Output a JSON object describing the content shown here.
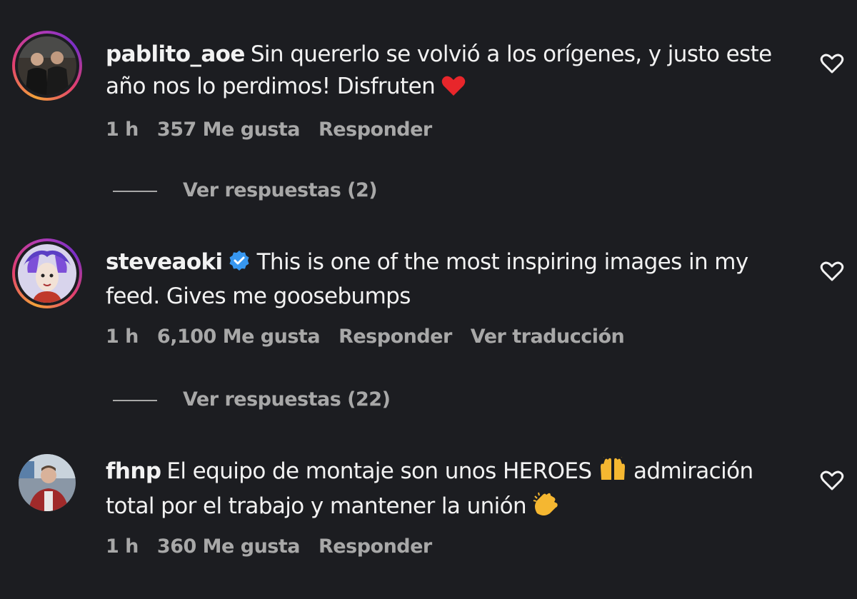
{
  "comments": [
    {
      "username": "pablito_aoe",
      "text": "Sin quererlo se volvió a los orígenes, y justo este año nos lo perdimos! Disfruten",
      "emoji": "red-heart",
      "time": "1 h",
      "likes": "357 Me gusta",
      "reply": "Responder",
      "replies": "Ver respuestas (2)"
    },
    {
      "username": "steveaoki",
      "verified": true,
      "text": "This is one of the most inspiring images in my feed. Gives me goosebumps",
      "time": "1 h",
      "likes": "6,100 Me gusta",
      "reply": "Responder",
      "translate": "Ver traducción",
      "replies": "Ver respuestas (22)"
    },
    {
      "username": "fhnp",
      "text_part1": "El equipo de montaje son unos HEROES",
      "emoji1": "raising-hands",
      "text_part2": "admiración total por el trabajo y mantener la unión",
      "emoji2": "clapping-hands",
      "time": "1 h",
      "likes": "360 Me gusta",
      "reply": "Responder"
    }
  ],
  "colors": {
    "background": "#1c1d21",
    "text": "#f2f2f2",
    "secondary_text": "#a8a8a8",
    "verified": "#3797f0"
  }
}
